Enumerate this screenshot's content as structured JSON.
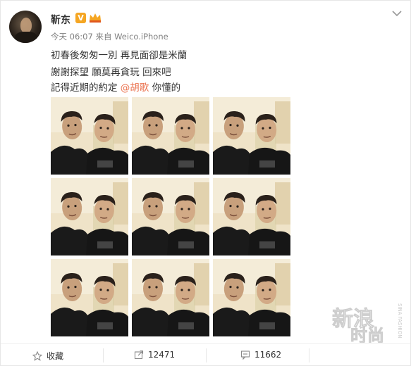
{
  "post": {
    "username": "靳东",
    "verified_mark": "V",
    "meta": "今天 06:07 来自 Weico.iPhone",
    "lines": {
      "line1": "初春後匆匆一別 再見面卻是米蘭",
      "line2": "謝謝探望 願莫再貪玩 回來吧",
      "line3_before": "記得近期的約定 ",
      "line3_mention": "@胡歌",
      "line3_after": " 你懂的"
    }
  },
  "actions": {
    "favorite_label": "收藏",
    "share_count": "12471",
    "comment_count": "11662"
  },
  "watermark": {
    "line1": "新浪",
    "line2": "时尚",
    "side": "SINA FASHION"
  },
  "colors": {
    "mention": "#eb7350",
    "badge": "#f5a623",
    "meta": "#808080"
  }
}
